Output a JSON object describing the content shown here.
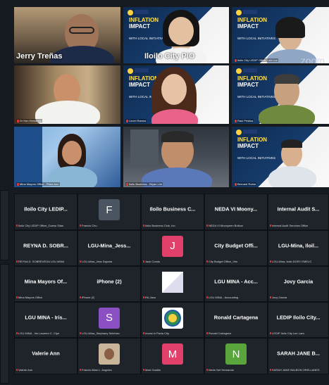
{
  "zoom_watermark": "zoom",
  "slide": {
    "title_line1": "INFLATION",
    "title_line2": "IMPACT",
    "sub": "WITH LOCAL INITIATIVES"
  },
  "video_tiles": [
    {
      "id": "v1",
      "label": "Jerry Treñas",
      "big": true
    },
    {
      "id": "v2",
      "label": "Iloilo City PIO",
      "big": true
    },
    {
      "id": "v3",
      "label": "Iloilo City LEDIP Office, Lee Lux",
      "big": false
    },
    {
      "id": "v4",
      "label": "Dr Ken Hernando",
      "big": false
    },
    {
      "id": "v5",
      "label": "Liezel Ramos",
      "big": false
    },
    {
      "id": "v6",
      "label": "Raul Pesitaz",
      "big": false
    },
    {
      "id": "v7",
      "label": "Mina Mayors Office - Rhea Ann",
      "big": false
    },
    {
      "id": "v8",
      "label": "Iloilo Business - Bryan Lim",
      "big": false
    },
    {
      "id": "v9",
      "label": "Bernard Rubia",
      "big": false
    }
  ],
  "tiles": [
    {
      "name": "Iloilo City LEDIP...",
      "sub": "Iloilo City LEDIP Office_Guess Silas",
      "avatar": ""
    },
    {
      "name": "",
      "sub": "Francis Chu",
      "avatar": "F",
      "color": "#4a5561"
    },
    {
      "name": "Iloilo Business C...",
      "sub": "Iloilo Business Club, Inc.",
      "avatar": ""
    },
    {
      "name": "NEDA VI Moony...",
      "sub": "NEDA VI Moonyeen Bolivar",
      "avatar": ""
    },
    {
      "name": "Internal Audit S...",
      "sub": "Internal Audit Services Office",
      "avatar": ""
    },
    {
      "name": "REYNA D. SOBR...",
      "sub": "REYNA D. SOBREVEGA LGU MINA",
      "avatar": ""
    },
    {
      "name": "LGU-Mina_Jess...",
      "sub": "LGU-Mina_Jess Sajonia",
      "avatar": ""
    },
    {
      "name": "",
      "sub": "Jack Condu",
      "avatar": "J",
      "color": "#e0406a"
    },
    {
      "name": "City Budget Offi...",
      "sub": "City Budget Office_Vim",
      "avatar": ""
    },
    {
      "name": "LGU-Mina, Iloil...",
      "sub": "LGU-Mina, Iloilo DORY EMELO",
      "avatar": ""
    },
    {
      "name": "Mina Mayors Of...",
      "sub": "Mina Mayors Office",
      "avatar": ""
    },
    {
      "name": "iPhone (2)",
      "sub": "iPhone (2)",
      "avatar": ""
    },
    {
      "name": "",
      "sub": "RA Jano",
      "avatar": "pic-doc"
    },
    {
      "name": "LGU MINA - Acc...",
      "sub": "LGU MINA - Accounting",
      "avatar": ""
    },
    {
      "name": "Jovy Garcia",
      "sub": "Jovy Garcia",
      "avatar": ""
    },
    {
      "name": "LGU MINA - Iris...",
      "sub": "LGU MINA - Iris Laureen C. Clpe",
      "avatar": ""
    },
    {
      "name": "",
      "sub": "LGU-Mina_Stephany Selebreo",
      "avatar": "S",
      "color": "#8a4fc2"
    },
    {
      "name": "",
      "sub": "Invest in Pavia City",
      "avatar": "pic-seal"
    },
    {
      "name": "Ronald Cartagena",
      "sub": "Ronald Cartagena",
      "avatar": ""
    },
    {
      "name": "LEDIP Iloilo City...",
      "sub": "LEDIP Iloilo City Lee Lara",
      "avatar": ""
    },
    {
      "name": "Valerie Ann",
      "sub": "Valerie Ann",
      "avatar": ""
    },
    {
      "name": "",
      "sub": "Francis Allan L. Angeles",
      "avatar": "pic-person"
    },
    {
      "name": "",
      "sub": "Maxi Gustilo",
      "avatar": "M",
      "color": "#e0406a"
    },
    {
      "name": "",
      "sub": "Nevin Nel Hernando",
      "avatar": "N",
      "color": "#5aa53b"
    },
    {
      "name": "SARAH JANE B...",
      "sub": "SARAH JANE BALBON ORELLANES",
      "avatar": ""
    }
  ]
}
